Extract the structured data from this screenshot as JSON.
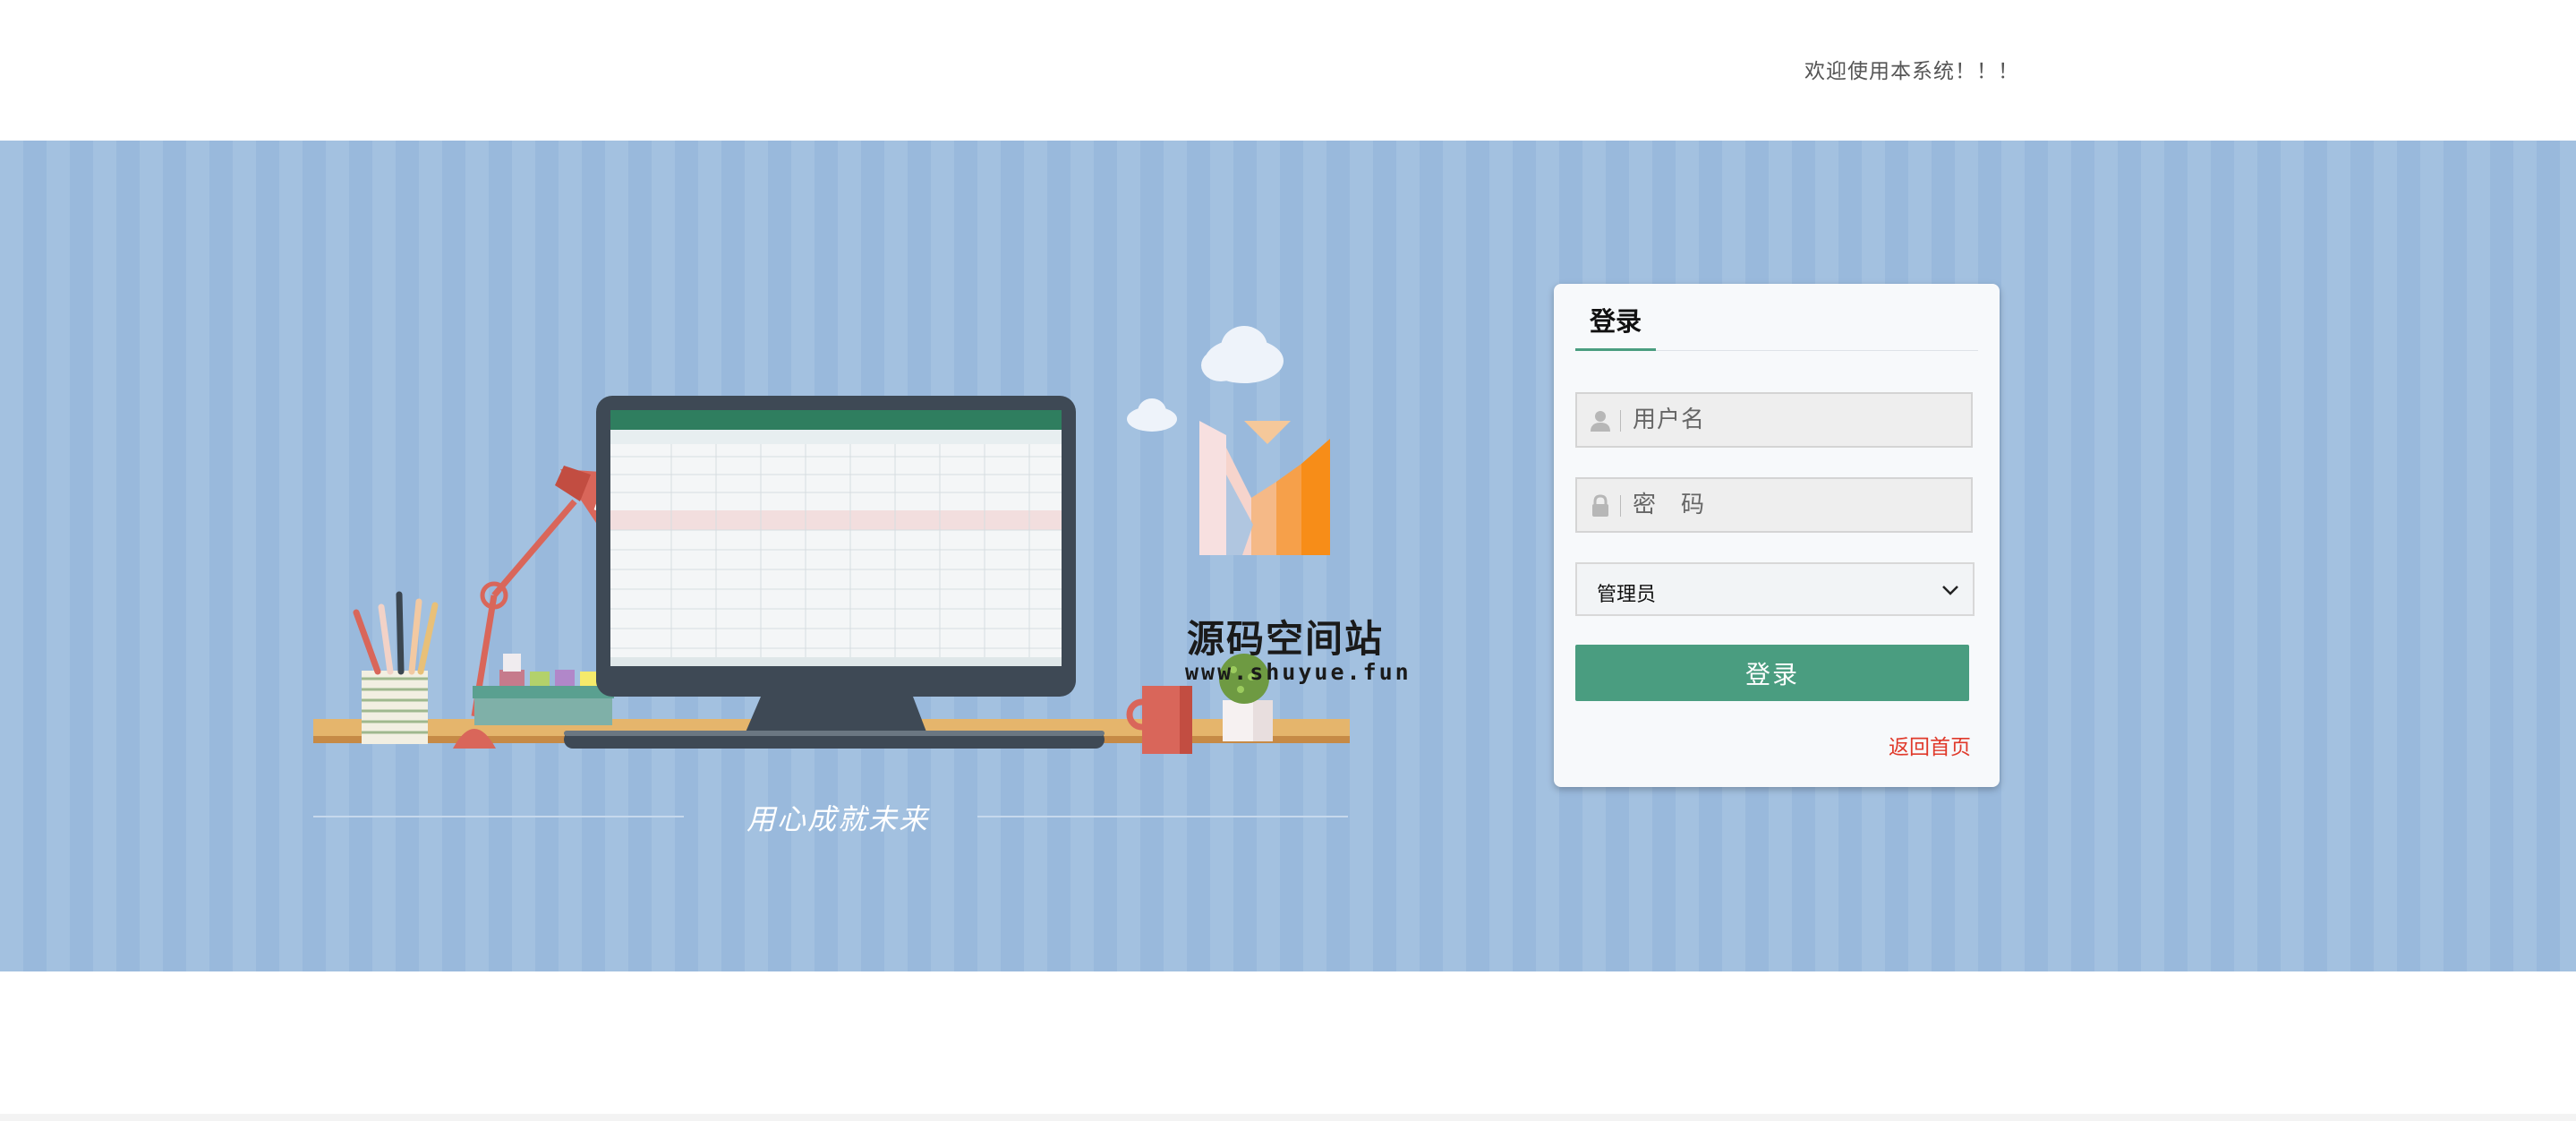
{
  "header": {
    "welcome_text": "欢迎使用本系统！！！"
  },
  "illustration": {
    "logo_title": "源码空间站",
    "logo_url": "www.shuyue.fun",
    "slogan": "用心成就未来"
  },
  "login": {
    "tab_label": "登录",
    "username_placeholder": "用户名",
    "password_placeholder": "密　码",
    "role_selected": "管理员",
    "submit_label": "登录",
    "back_home_label": "返回首页"
  },
  "colors": {
    "accent": "#4a9d80",
    "link_red": "#e03a2b",
    "banner_blue": "#a0bfdf"
  },
  "icons": {
    "username": "user-icon",
    "password": "lock-icon",
    "select": "chevron-down-icon"
  }
}
